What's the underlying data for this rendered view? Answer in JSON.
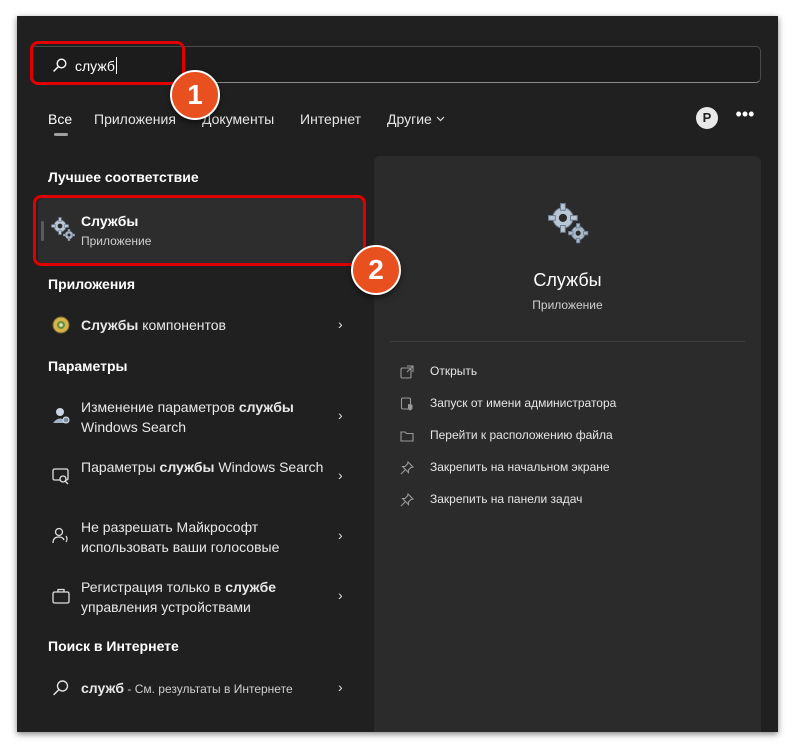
{
  "search": {
    "query": "служб"
  },
  "tabs": [
    {
      "label": "Все"
    },
    {
      "label": "Приложения"
    },
    {
      "label": "Документы"
    },
    {
      "label": "Интернет"
    },
    {
      "label": "Другие ⌵"
    }
  ],
  "account": {
    "initial": "P"
  },
  "more_label": "•••",
  "left": {
    "best_match_title": "Лучшее соответствие",
    "best_match": {
      "name": "Службы",
      "type": "Приложение"
    },
    "apps_title": "Приложения",
    "apps": [
      {
        "bold": "Службы",
        "rest": " компонентов"
      }
    ],
    "settings_title": "Параметры",
    "settings": [
      {
        "pre": "Изменение параметров ",
        "bold": "службы",
        "post": "Windows Search",
        "post_inline": "ы"
      },
      {
        "pre": "Параметры ",
        "bold": "службы",
        "post": " Windows Search"
      },
      {
        "text": "Не разрешать Майкрософт использовать ваши голосовые"
      },
      {
        "pre": "Регистрация только в ",
        "bold": "службе",
        "post": " управления устройствами"
      }
    ],
    "web_title": "Поиск в Интернете",
    "web": {
      "bold": "служб",
      "rest": " - См. результаты в Интернете"
    }
  },
  "right": {
    "name": "Службы",
    "type": "Приложение",
    "actions": [
      {
        "label": "Открыть",
        "icon": "open-icon"
      },
      {
        "label": "Запуск от имени администратора",
        "icon": "shield-icon"
      },
      {
        "label": "Перейти к расположению файла",
        "icon": "folder-icon"
      },
      {
        "label": "Закрепить на начальном экране",
        "icon": "pin-icon"
      },
      {
        "label": "Закрепить на панели задач",
        "icon": "pin-icon"
      }
    ]
  },
  "callouts": [
    {
      "number": "1"
    },
    {
      "number": "2"
    }
  ],
  "colors": {
    "callout_border": "#e10000",
    "badge_fill": "#e8501f",
    "panel_bg": "#202020"
  }
}
